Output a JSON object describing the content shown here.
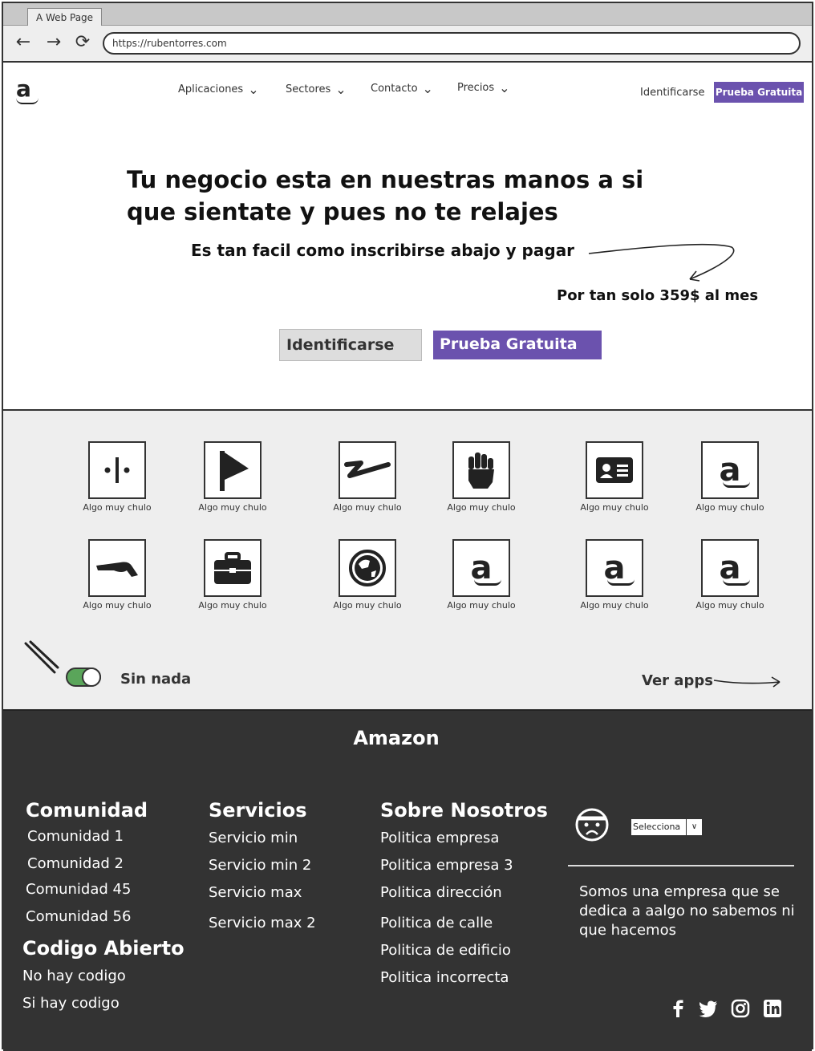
{
  "browser": {
    "tab_title": "A Web Page",
    "url": "https://rubentorres.com"
  },
  "header": {
    "logo": "a",
    "menu": [
      "Aplicaciones",
      "Sectores",
      "Contacto",
      "Precios"
    ],
    "login": "Identificarse",
    "trial": "Prueba Gratuita"
  },
  "hero": {
    "title": "Tu negocio esta en nuestras manos a si que sientate y pues no te relajes",
    "subtitle": "Es tan facil como inscribirse abajo y pagar",
    "price_note": "Por tan solo 359$ al mes",
    "login_button": "Identificarse",
    "trial_button": "Prueba Gratuita"
  },
  "apps": {
    "items": [
      {
        "caption": "Algo muy chulo",
        "icon": "divider-dots-icon"
      },
      {
        "caption": "Algo muy chulo",
        "icon": "flag-icon"
      },
      {
        "caption": "Algo muy chulo",
        "icon": "squiggle-icon"
      },
      {
        "caption": "Algo muy chulo",
        "icon": "fist-icon"
      },
      {
        "caption": "Algo muy chulo",
        "icon": "id-card-icon"
      },
      {
        "caption": "Algo muy chulo",
        "icon": "amazon-icon"
      },
      {
        "caption": "Algo muy chulo",
        "icon": "pointing-hand-icon"
      },
      {
        "caption": "Algo muy chulo",
        "icon": "briefcase-icon"
      },
      {
        "caption": "Algo muy chulo",
        "icon": "globe-icon"
      },
      {
        "caption": "Algo muy chulo",
        "icon": "amazon-icon"
      },
      {
        "caption": "Algo muy chulo",
        "icon": "amazon-icon"
      },
      {
        "caption": "Algo muy chulo",
        "icon": "amazon-icon"
      }
    ],
    "toggle_label": "Sin nada",
    "toggle_on": true,
    "more_link": "Ver apps"
  },
  "footer": {
    "title": "Amazon",
    "comunidad": {
      "heading": "Comunidad",
      "links": [
        "Comunidad 1",
        "Comunidad 2",
        "Comunidad 45",
        "Comunidad 56"
      ]
    },
    "codigo": {
      "heading": "Codigo Abierto",
      "links": [
        "No hay codigo",
        "Si hay codigo"
      ]
    },
    "servicios": {
      "heading": "Servicios",
      "links": [
        "Servicio min",
        "Servicio min 2",
        "Servicio max",
        "Servicio max 2"
      ]
    },
    "sobre": {
      "heading": "Sobre Nosotros",
      "links": [
        "Politica empresa",
        "Politica empresa 3",
        "Politica dirección",
        "Politica de calle",
        "Politica de edificio",
        "Politica incorrecta"
      ]
    },
    "select_value": "Selecciona",
    "description": "Somos una empresa que se dedica a aalgo no sabemos ni que hacemos",
    "social": [
      "facebook-icon",
      "twitter-icon",
      "instagram-icon",
      "linkedin-icon"
    ]
  },
  "colors": {
    "accent": "#6b52ae",
    "footer_bg": "#333333",
    "apps_bg": "#eeeeee",
    "toggle_on": "#5aa55a"
  }
}
